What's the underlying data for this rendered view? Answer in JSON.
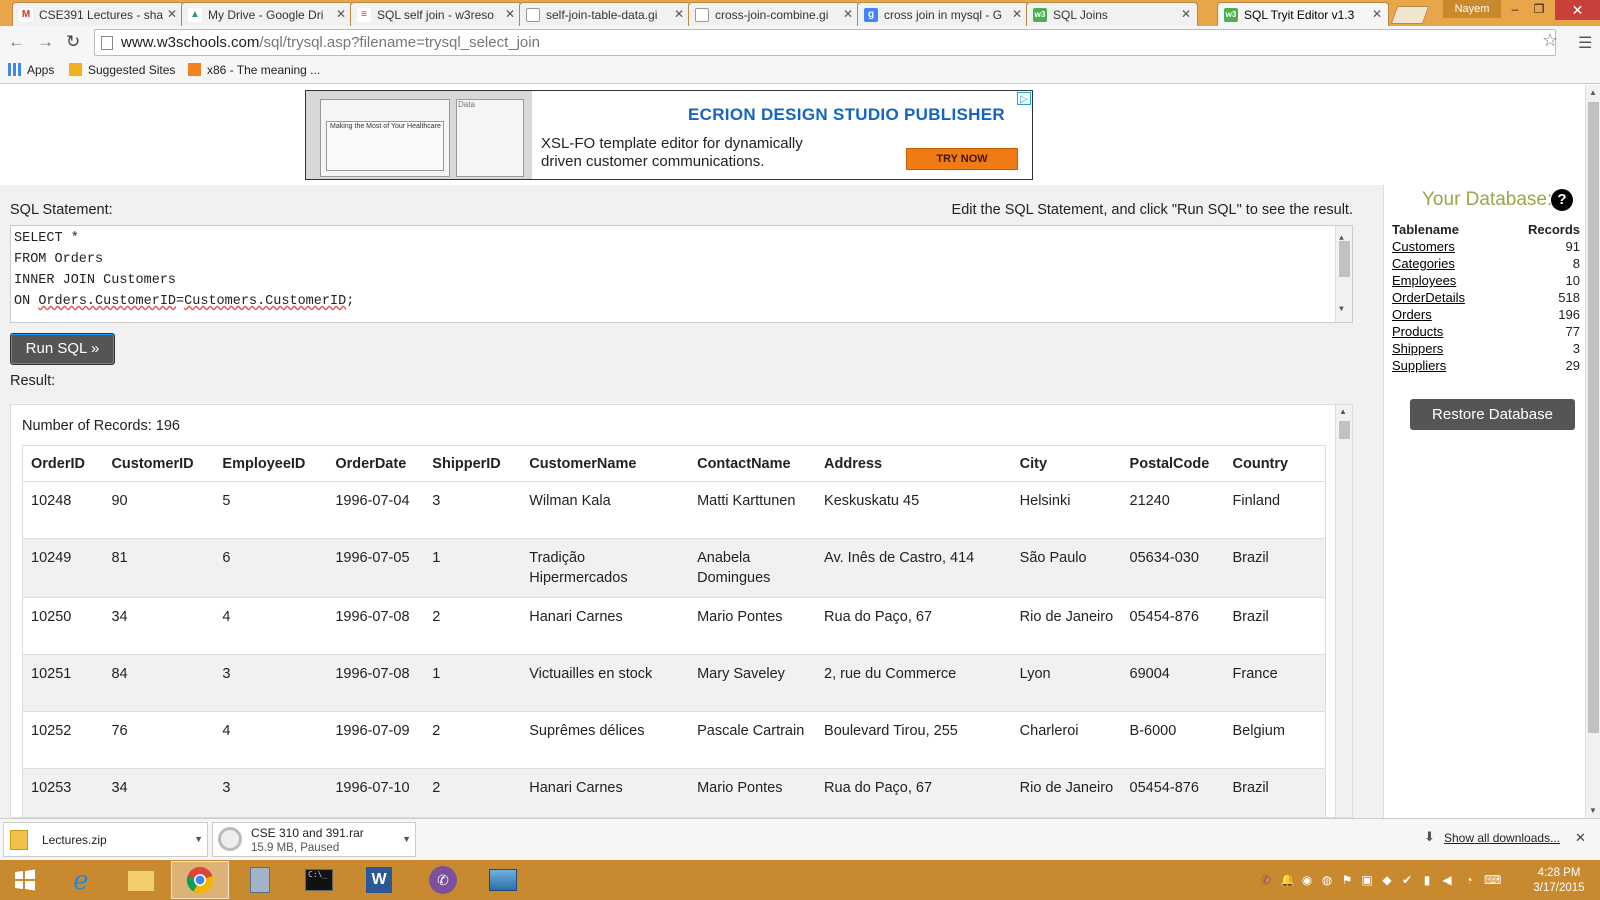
{
  "browser": {
    "tabs": [
      {
        "title": "CSE391 Lectures - sha",
        "icon": "gmail-icon",
        "color": "#d93025",
        "glyph": "M"
      },
      {
        "title": "My Drive - Google Dri",
        "icon": "drive-icon",
        "color": "#1fa463",
        "glyph": "▲"
      },
      {
        "title": "SQL self join - w3reso",
        "icon": "w3resource-icon",
        "color": "#c0392b",
        "glyph": "≡"
      },
      {
        "title": "self-join-table-data.gi",
        "icon": "page-icon",
        "color": "#999999",
        "glyph": ""
      },
      {
        "title": "cross-join-combine.gi",
        "icon": "page-icon",
        "color": "#999999",
        "glyph": ""
      },
      {
        "title": "cross join in mysql - G",
        "icon": "google-icon",
        "color": "#4285f4",
        "glyph": "g"
      },
      {
        "title": "SQL Joins",
        "icon": "w3schools-icon",
        "color": "#4caf50",
        "glyph": "w3"
      },
      {
        "title": "SQL Tryit Editor v1.3",
        "icon": "w3schools-icon",
        "color": "#4caf50",
        "glyph": "w3"
      }
    ],
    "user": "Nayem",
    "url_host": "www.w3schools.com",
    "url_path": "/sql/trysql.asp?filename=trysql_select_join",
    "bookmarks": [
      {
        "label": "Apps"
      },
      {
        "label": "Suggested Sites"
      },
      {
        "label": "x86 - The meaning ..."
      }
    ]
  },
  "ad": {
    "headline": "ECRION DESIGN STUDIO PUBLISHER",
    "body_line1": "XSL-FO template editor for dynamically",
    "body_line2": "driven customer communications.",
    "cta": "TRY NOW",
    "thumb_title": "Making the Most of Your Healthcare",
    "thumb_data": "Data"
  },
  "editor": {
    "label": "SQL Statement:",
    "hint": "Edit the SQL Statement, and click \"Run SQL\" to see the result.",
    "line1": "SELECT *",
    "line2": "FROM Orders",
    "line3": "INNER JOIN Customers",
    "line4_prefix": "ON ",
    "line4_a": "Orders.CustomerID",
    "line4_eq": "=",
    "line4_b": "Customers.CustomerID",
    "line4_suffix": ";",
    "run_label": "Run SQL »"
  },
  "result": {
    "label": "Result:",
    "count_label": "Number of Records: 196",
    "columns": [
      "OrderID",
      "CustomerID",
      "EmployeeID",
      "OrderDate",
      "ShipperID",
      "CustomerName",
      "ContactName",
      "Address",
      "City",
      "PostalCode",
      "Country"
    ],
    "rows": [
      [
        "10248",
        "90",
        "5",
        "1996-07-04",
        "3",
        "Wilman Kala",
        "Matti Karttunen",
        "Keskuskatu 45",
        "Helsinki",
        "21240",
        "Finland"
      ],
      [
        "10249",
        "81",
        "6",
        "1996-07-05",
        "1",
        "Tradição Hipermercados",
        "Anabela Domingues",
        "Av. Inês de Castro, 414",
        "São Paulo",
        "05634-030",
        "Brazil"
      ],
      [
        "10250",
        "34",
        "4",
        "1996-07-08",
        "2",
        "Hanari Carnes",
        "Mario Pontes",
        "Rua do Paço, 67",
        "Rio de Janeiro",
        "05454-876",
        "Brazil"
      ],
      [
        "10251",
        "84",
        "3",
        "1996-07-08",
        "1",
        "Victuailles en stock",
        "Mary Saveley",
        "2, rue du Commerce",
        "Lyon",
        "69004",
        "France"
      ],
      [
        "10252",
        "76",
        "4",
        "1996-07-09",
        "2",
        "Suprêmes délices",
        "Pascale Cartrain",
        "Boulevard Tirou, 255",
        "Charleroi",
        "B-6000",
        "Belgium"
      ],
      [
        "10253",
        "34",
        "3",
        "1996-07-10",
        "2",
        "Hanari Carnes",
        "Mario Pontes",
        "Rua do Paço, 67",
        "Rio de Janeiro",
        "05454-876",
        "Brazil"
      ]
    ]
  },
  "database": {
    "title": "Your Database:",
    "help": "?",
    "col_table": "Tablename",
    "col_records": "Records",
    "tables": [
      {
        "name": "Customers",
        "records": "91"
      },
      {
        "name": "Categories",
        "records": "8"
      },
      {
        "name": "Employees",
        "records": "10"
      },
      {
        "name": "OrderDetails",
        "records": "518"
      },
      {
        "name": "Orders",
        "records": "196"
      },
      {
        "name": "Products",
        "records": "77"
      },
      {
        "name": "Shippers",
        "records": "3"
      },
      {
        "name": "Suppliers",
        "records": "29"
      }
    ],
    "restore_label": "Restore Database"
  },
  "downloads": {
    "items": [
      {
        "name": "Lectures.zip",
        "status": ""
      },
      {
        "name": "CSE 310 and 391.rar",
        "status": "15.9 MB, Paused"
      }
    ],
    "show_all": "Show all downloads..."
  },
  "taskbar": {
    "time": "4:28 PM",
    "date": "3/17/2015",
    "apps": [
      "start-button",
      "internet-explorer-icon",
      "file-explorer-icon",
      "chrome-icon",
      "calculator-icon",
      "command-prompt-icon",
      "word-icon",
      "viber-icon",
      "photo-viewer-icon"
    ]
  },
  "colors": {
    "accent_db_title": "#9aa64a",
    "ad_headline": "#1565c0",
    "taskbar": "#c98a2f",
    "button": "#555555"
  }
}
